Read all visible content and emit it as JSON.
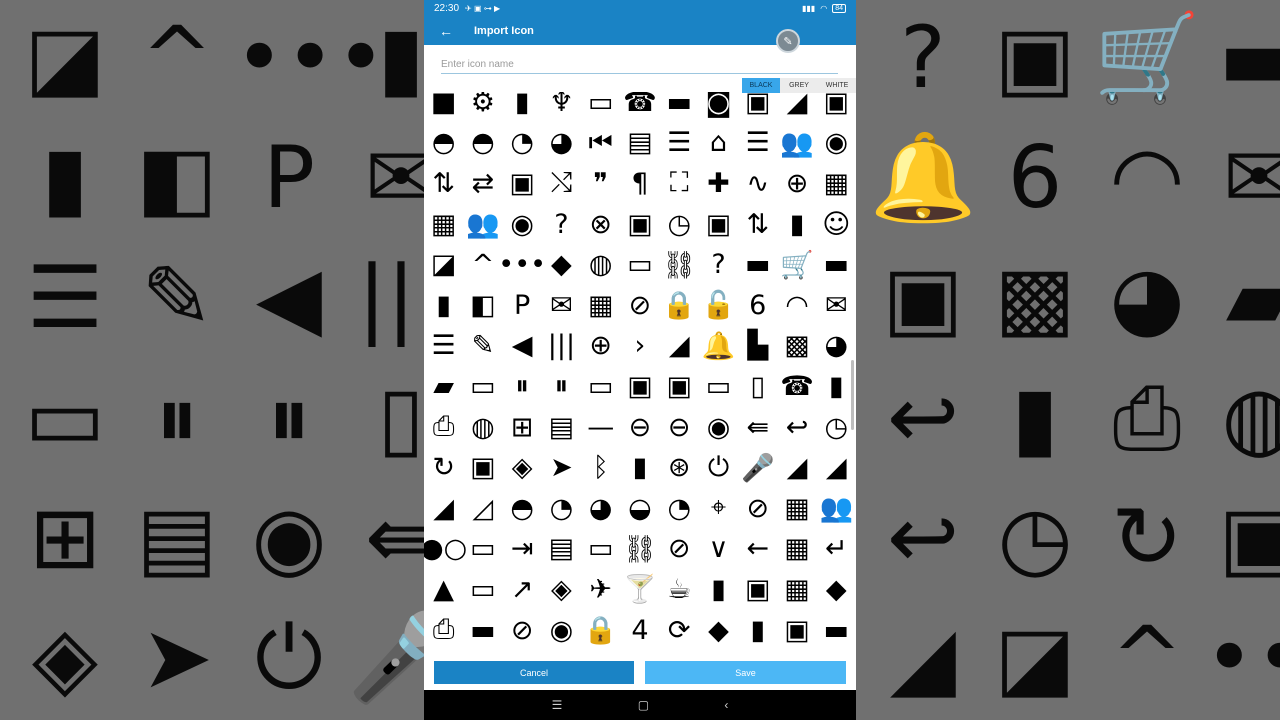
{
  "status_bar": {
    "time": "22:30",
    "battery": "84"
  },
  "app_bar": {
    "title": "Import Icon",
    "back_icon": "arrow-back-icon",
    "fab_icon": "edit-pencil-icon"
  },
  "search": {
    "placeholder": "Enter icon name",
    "value": ""
  },
  "color_toggle": {
    "options": [
      "BLACK",
      "GREY",
      "WHITE"
    ],
    "selected": "BLACK"
  },
  "icon_glyphs": [
    "■",
    "⚙",
    "▮",
    "♆",
    "▭",
    "☎",
    "▬",
    "◙",
    "▣",
    "◢",
    "▣",
    "◓",
    "◓",
    "◔",
    "◕",
    "⏮",
    "▤",
    "☰",
    "⌂",
    "☰",
    "👥",
    "◉",
    "⇅",
    "⇄",
    "▣",
    "⤭",
    "❞",
    "¶",
    "⛶",
    "✚",
    "∿",
    "⊕",
    "▦",
    "▦",
    "👥",
    "◉",
    "?",
    "⊗",
    "▣",
    "◷",
    "▣",
    "⇅",
    "▮",
    "☺",
    "◪",
    "^",
    "•••",
    "◆",
    "◍",
    "▭",
    "⛓",
    "?",
    "▬",
    "🛒",
    "▬",
    "▮",
    "◧",
    "P",
    "✉",
    "▦",
    "⊘",
    "🔒",
    "🔓",
    "6",
    "◠",
    "✉",
    "☰",
    "✎",
    "◀",
    "|||",
    "⊕",
    "›",
    "◢",
    "🔔",
    "▙",
    "▩",
    "◕",
    "▰",
    "▭",
    "⏸",
    "⏸",
    "▭",
    "▣",
    "▣",
    "▭",
    "▯",
    "☎",
    "▮",
    "⎙",
    "◍",
    "⊞",
    "▤",
    "—",
    "⊖",
    "⊖",
    "◉",
    "⇚",
    "↩",
    "◷",
    "↻",
    "▣",
    "◈",
    "➤",
    "ᛒ",
    "▮",
    "⊛",
    "⏻",
    "🎤",
    "◢",
    "◢",
    "◢",
    "◿",
    "◓",
    "◔",
    "◕",
    "◒",
    "◔",
    "⌖",
    "⊘",
    "▦",
    "👥",
    "●○",
    "▭",
    "⇥",
    "▤",
    "▭",
    "⛓",
    "⊘",
    "∨",
    "←",
    "▦",
    "↵",
    "▲",
    "▭",
    "↗",
    "◈",
    "✈",
    "🍸",
    "☕",
    "▮",
    "▣",
    "▦",
    "◆",
    "⎙",
    "▬",
    "⊘",
    "◉",
    "🔒",
    "4",
    "⟳",
    "◆",
    "▮",
    "▣",
    "▬",
    "▬",
    "▬",
    "▬",
    "▬",
    "▬",
    "▬",
    "▬",
    "▬",
    "▬",
    "▬",
    "▬"
  ],
  "bg_glyphs": [
    "◪",
    "^",
    "•••",
    "▮",
    "?",
    "▣",
    "🛒",
    "▬",
    "▮",
    "◧",
    "P",
    "✉",
    "🔔",
    "6",
    "◠",
    "✉",
    "☰",
    "✎",
    "◀",
    "|||",
    "▣",
    "▩",
    "◕",
    "▰",
    "▭",
    "⏸",
    "⏸",
    "▯",
    "↩",
    "▮",
    "⎙",
    "◍",
    "⊞",
    "▤",
    "◉",
    "⇚",
    "↩",
    "◷",
    "↻",
    "▣",
    "◈",
    "➤",
    "⏻",
    "🎤",
    "◢"
  ],
  "actions": {
    "cancel": "Cancel",
    "save": "Save"
  },
  "nav": {
    "menu": "☰",
    "home": "▢",
    "back": "‹"
  }
}
